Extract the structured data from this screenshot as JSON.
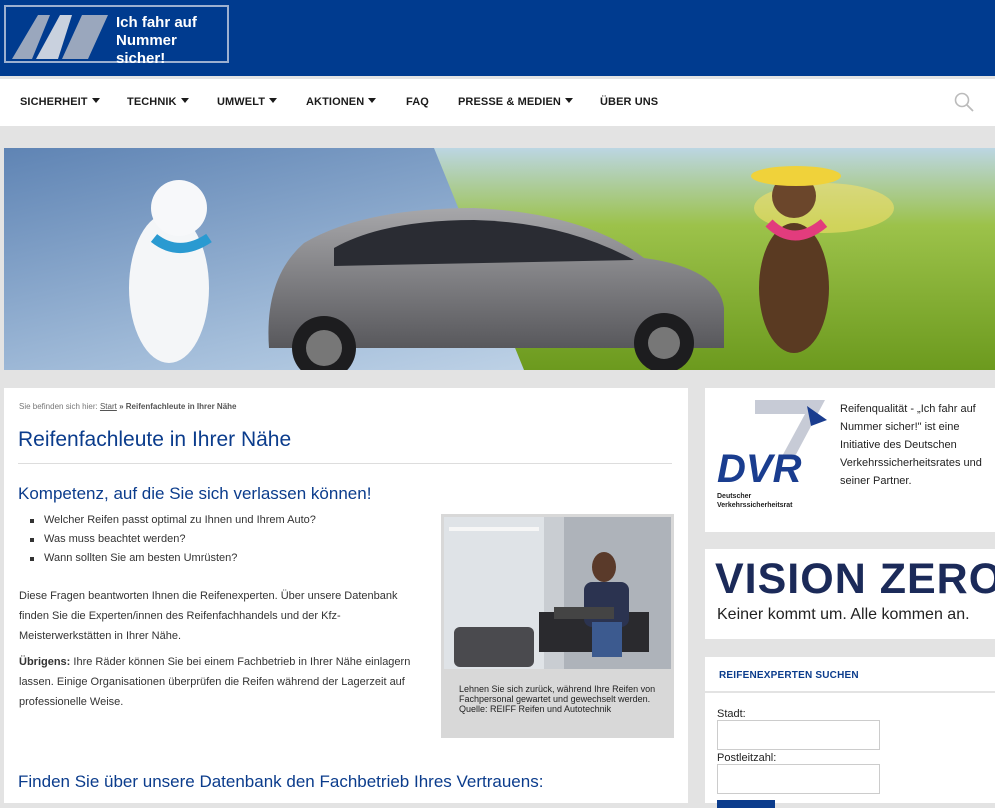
{
  "brand": {
    "logo_text_line1": "Ich fahr auf",
    "logo_text_line2": "Nummer sicher!"
  },
  "nav": {
    "items": [
      {
        "label": "SICHERHEIT",
        "has_caret": true
      },
      {
        "label": "TECHNIK",
        "has_caret": true
      },
      {
        "label": "UMWELT",
        "has_caret": true
      },
      {
        "label": "AKTIONEN",
        "has_caret": true
      },
      {
        "label": "FAQ",
        "has_caret": false
      },
      {
        "label": "PRESSE & MEDIEN",
        "has_caret": true
      },
      {
        "label": "ÜBER UNS",
        "has_caret": false
      }
    ],
    "search_icon": "search-icon"
  },
  "breadcrumb": {
    "prefix": "Sie befinden sich hier:",
    "start": "Start",
    "separator": "»",
    "current": "Reifenfachleute in Ihrer Nähe"
  },
  "main": {
    "title": "Reifenfachleute in Ihrer Nähe",
    "heading1": "Kompetenz, auf die Sie sich verlassen können!",
    "bullets": [
      "Welcher Reifen passt optimal zu Ihnen und Ihrem Auto?",
      "Was muss beachtet werden?",
      "Wann sollten Sie am besten Umrüsten?"
    ],
    "para1": "Diese Fragen beantworten Ihnen die Reifenexperten. Über unsere Datenbank finden Sie die Experten/innen des Reifenfachhandels und der Kfz-Meisterwerkstätten in Ihrer Nähe.",
    "para2_bold": "Übrigens:",
    "para2": " Ihre Räder können Sie bei einem Fachbetrieb in Ihrer Nähe einlagern lassen. Einige Organisationen überprüfen die Reifen während der Lagerzeit auf professionelle Weise.",
    "figure_caption": "Lehnen Sie sich zurück, während Ihre Reifen von Fachpersonal gewartet und gewechselt werden.",
    "figure_source": "Quelle: REIFF Reifen und Autotechnik",
    "heading2": "Finden Sie über unsere Datenbank den Fachbetrieb Ihres Vertrauens:"
  },
  "sidebar": {
    "dvr_text": "Reifenqualität - „Ich fahr auf Nummer sicher!\" ist eine Initiative des Deutschen Verkehrssicherheitsrates und seiner Partner.",
    "dvr_logo_letters": "DVR",
    "dvr_sub_line1": "Deutscher",
    "dvr_sub_line2": "Verkehrssicherheitsrat",
    "vision_title": "VISION ZERO.",
    "vision_sub": "Keiner kommt um. Alle kommen an.",
    "search_heading": "REIFENEXPERTEN SUCHEN",
    "city_label": "Stadt:",
    "city_value": "",
    "zip_label": "Postleitzahl:",
    "zip_value": ""
  },
  "colors": {
    "brand_blue": "#003b8f",
    "heading_blue": "#0b3c8c",
    "bg_gray": "#e3e3e3"
  }
}
